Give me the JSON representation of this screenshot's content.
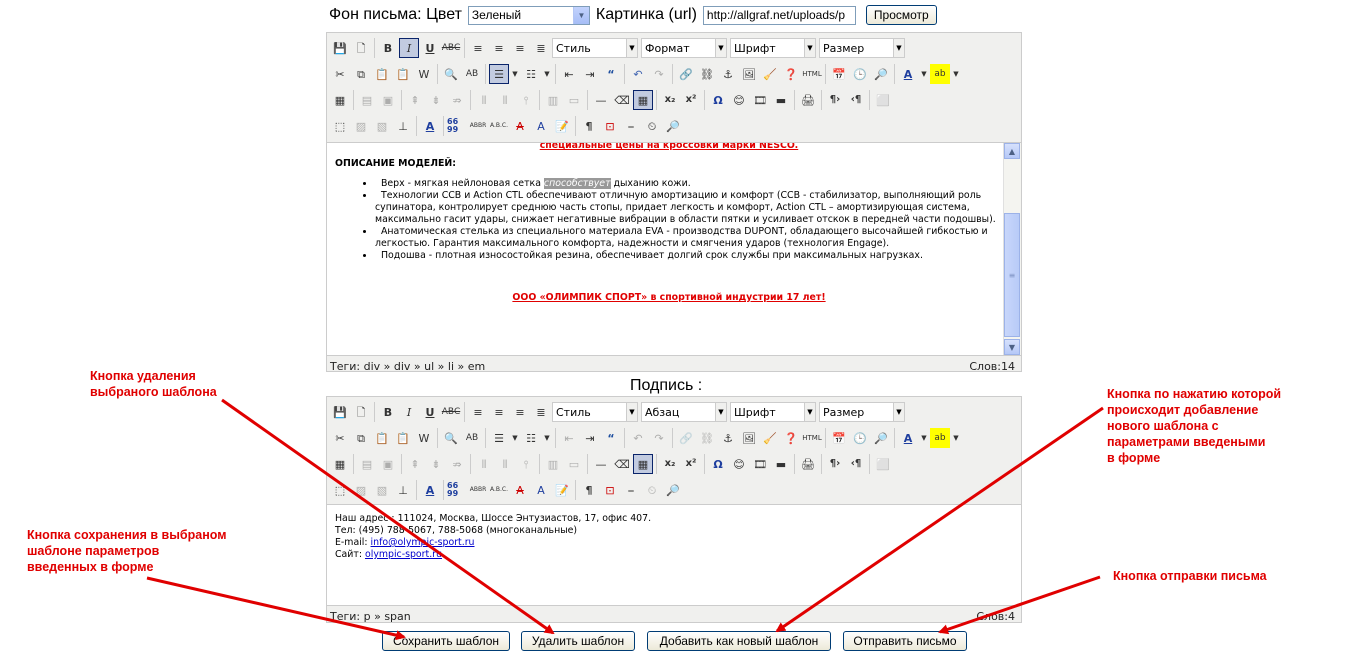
{
  "background_row": {
    "label": "Фон письма: Цвет",
    "color_value": "Зеленый",
    "picture_label": "Картинка (url)",
    "picture_url": "http://allgraf.net/uploads/p",
    "view_button": "Просмотр"
  },
  "editor1": {
    "style_select": "Стиль",
    "format_select": "Формат",
    "font_select": "Шрифт",
    "size_select": "Размер",
    "content": {
      "top_line": "специальные цены на  кроссовки марки NESCO.",
      "heading": "ОПИСАНИЕ МОДЕЛЕЙ:",
      "items": [
        {
          "pre": "Верх - мягкая нейлоновая сетка ",
          "hl": "способствует",
          "post": " дыханию кожи."
        },
        {
          "text": "Технологии CCB и Action CTL  обеспечивают отличную амортизацию и комфорт  (CCB - стабилизатор, выполняющий роль супинатора, контролирует среднюю часть стопы, придает легкость и комфорт, Action CTL – амортизирующая система, максимально гасит удары, снижает негативные вибрации в области пятки и усиливает отскок  в передней части подошвы)."
        },
        {
          "text": "Анатомическая стелька из специального материала EVA  - производства DUPONT, обладающего высочайшей гибкостью и легкостью. Гарантия максимального комфорта, надежности и смягчения ударов (технология Engage)."
        },
        {
          "text": "Подошва - плотная износостойкая резина,  обеспечивает долгий срок службы при максимальных нагрузках."
        }
      ],
      "footer": "ООО «ОЛИМПИК СПОРТ» в спортивной индустрии 17 лет!"
    },
    "status_path": "Теги: div » div » ul » li » em",
    "word_count": "Слов:14"
  },
  "signature_label": "Подпись  :",
  "editor2": {
    "style_select": "Стиль",
    "format_select": "Абзац",
    "font_select": "Шрифт",
    "size_select": "Размер",
    "lines": {
      "address": "Наш адрес : 111024, Москва, Шоссе Энтузиастов, 17, офис 407.",
      "phone": "Тел: (495) 788-5067, 788-5068 (многоканальные)",
      "email_label": "E-mail: ",
      "email": "info@olympic-sport.ru",
      "site_label": "Сайт: ",
      "site": "olympic-sport.ru"
    },
    "status_path": "Теги: p » span",
    "word_count": "Слов:4"
  },
  "buttons": {
    "save": "Сохранить шаблон",
    "delete": "Удалить шаблон",
    "add_new": "Добавить как новый шаблон",
    "send": "Отправить письмо"
  },
  "annotations": {
    "delete_note": [
      "Кнопка удаления",
      "выбраного шаблона"
    ],
    "add_note": [
      "Кнопка по нажатию которой",
      "происходит добавление",
      "нового шаблона с",
      "параметрами введеными",
      "в форме"
    ],
    "save_note": [
      "Кнопка сохранения в выбраном",
      "шаблоне параметров",
      "введенных в форме"
    ],
    "send_note": [
      "Кнопка отправки письма"
    ],
    "color": "#e00000"
  }
}
